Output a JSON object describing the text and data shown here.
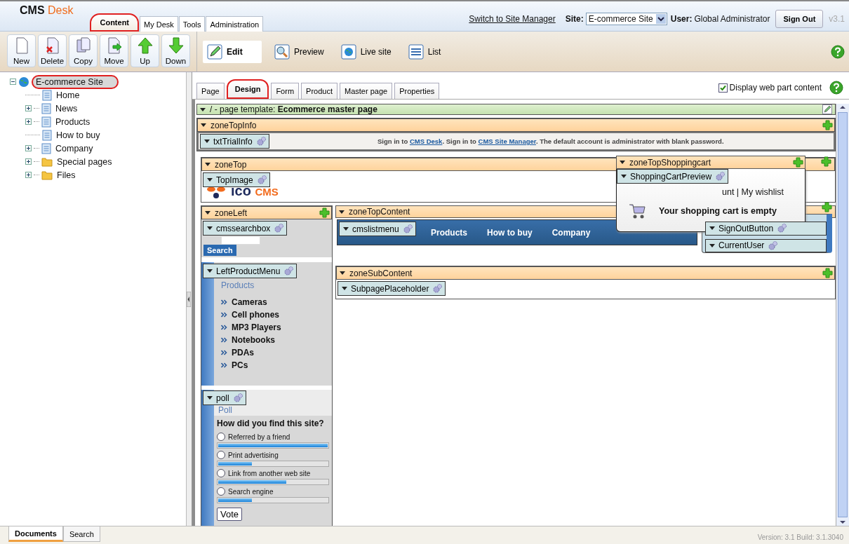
{
  "header": {
    "logo_main": "CMS",
    "logo_accent": "Desk",
    "switch_link": "Switch to Site Manager",
    "site_label": "Site:",
    "site_value": "E-commerce Site",
    "user_label": "User:",
    "user_name": "Global Administrator",
    "sign_out": "Sign Out",
    "version": "v3.1"
  },
  "main_tabs": [
    {
      "label": "Content",
      "selected": true
    },
    {
      "label": "My Desk",
      "selected": false
    },
    {
      "label": "Tools",
      "selected": false
    },
    {
      "label": "Administration",
      "selected": false
    }
  ],
  "toolbar": [
    {
      "label": "New",
      "kind": "new"
    },
    {
      "label": "Delete",
      "kind": "delete"
    },
    {
      "label": "Copy",
      "kind": "copy"
    },
    {
      "label": "Move",
      "kind": "move"
    },
    {
      "label": "Up",
      "kind": "up"
    },
    {
      "label": "Down",
      "kind": "down"
    }
  ],
  "tree": {
    "label": "E-commerce Site",
    "selected": true,
    "expanded": true,
    "children": [
      {
        "label": "Home",
        "kind": "page",
        "selected": false
      },
      {
        "label": "News",
        "kind": "page",
        "selected": false,
        "expanded": false
      },
      {
        "label": "Products",
        "kind": "page",
        "selected": false,
        "expanded": false
      },
      {
        "label": "How to buy",
        "kind": "page",
        "selected": false
      },
      {
        "label": "Company",
        "kind": "page",
        "selected": false,
        "expanded": false
      },
      {
        "label": "Special pages",
        "kind": "folder",
        "selected": false,
        "expanded": false
      },
      {
        "label": "Files",
        "kind": "folder",
        "selected": false,
        "expanded": false
      }
    ]
  },
  "view_modes": [
    {
      "label": "Edit",
      "kind": "edit",
      "selected": true
    },
    {
      "label": "Preview",
      "kind": "preview",
      "selected": false
    },
    {
      "label": "Live site",
      "kind": "live",
      "selected": false
    },
    {
      "label": "List",
      "kind": "list",
      "selected": false
    }
  ],
  "page_tabs": [
    {
      "label": "Page",
      "selected": false
    },
    {
      "label": "Design",
      "selected": true
    },
    {
      "label": "Form",
      "selected": false
    },
    {
      "label": "Product",
      "selected": false
    },
    {
      "label": "Master page",
      "selected": false
    },
    {
      "label": "Properties",
      "selected": false
    }
  ],
  "display_web_part_content": {
    "label": "Display web part content",
    "checked": true
  },
  "design": {
    "template": "/ - page template: **Ecommerce master page**",
    "zone_top_info": {
      "name": "zoneTopInfo",
      "web_part": "txtTrialInfo",
      "text": [
        {
          "text": "Sign in to ",
          "kind": "plain"
        },
        {
          "text": "CMS Desk",
          "kind": "link"
        },
        {
          "text": ". Sign in to ",
          "kind": "plain"
        },
        {
          "text": "CMS Site Manager",
          "kind": "link"
        },
        {
          "text": ". The default account is administrator with blank password.",
          "kind": "plain"
        }
      ]
    },
    "zone_top": {
      "name": "zoneTop",
      "web_part": "TopImage",
      "logo_dark": "ico",
      "logo_accent": "CMS"
    },
    "zone_cart": {
      "name": "zoneTopShoppingcart",
      "web_part": "ShoppingCartPreview",
      "links": "unt | My wishlist",
      "message": "Your shopping cart is empty"
    },
    "zone_left": {
      "name": "zoneLeft",
      "search_web_part": "cmssearchbox",
      "search_button": "Search",
      "menu_web_part": "LeftProductMenu",
      "menu_title": "Products",
      "menu_items": [
        "Cameras",
        "Cell phones",
        "MP3 Players",
        "Notebooks",
        "PDAs",
        "PCs"
      ],
      "poll_web_part": "poll",
      "poll_title": "Poll",
      "question": "How did you find this site?",
      "options": [
        {
          "label": "Referred by a friend",
          "selected": false,
          "level": 1.0
        },
        {
          "label": "Print advertising",
          "selected": false,
          "level": 0.31
        },
        {
          "label": "Link from another web site",
          "selected": false,
          "level": 0.62
        },
        {
          "label": "Search engine",
          "selected": false,
          "level": 0.31
        }
      ],
      "vote": "Vote"
    },
    "zone_top_content": {
      "name": "zoneTopContent",
      "web_part": "cmslistmenu",
      "items": [
        "Products",
        "How to buy",
        "Company"
      ]
    },
    "zone_user": {
      "web_parts": [
        "SignOutButton",
        "CurrentUser"
      ]
    },
    "zone_sub_content": {
      "name": "zoneSubContent",
      "web_part": "SubpagePlaceholder"
    }
  },
  "bottom_tabs": [
    {
      "label": "Documents",
      "selected": true
    },
    {
      "label": "Search",
      "selected": false
    }
  ],
  "build": "Version: 3.1 Build: 3.1.3040"
}
